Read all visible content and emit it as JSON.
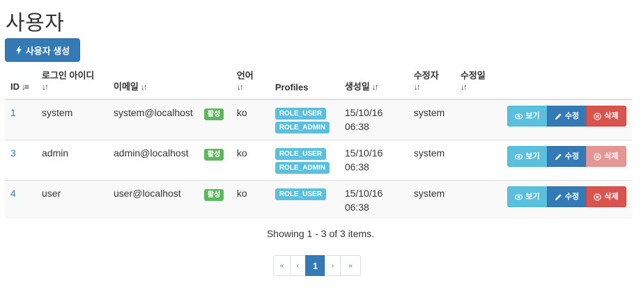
{
  "page": {
    "title": "사용자"
  },
  "toolbar": {
    "create_label": "사용자 생성"
  },
  "table": {
    "headers": {
      "id": "ID",
      "login": "로그인 아이디",
      "email": "이메일",
      "lang": "언어",
      "profiles": "Profiles",
      "created": "생성일",
      "modifier": "수정자",
      "modified": "수정일"
    },
    "rows": [
      {
        "id": "1",
        "login": "system",
        "email": "system@localhost",
        "status": "활성",
        "lang": "ko",
        "roles": [
          "ROLE_USER",
          "ROLE_ADMIN"
        ],
        "created_date": "15/10/16",
        "created_time": "06:38",
        "modifier": "system",
        "modified": "",
        "delete_disabled": false
      },
      {
        "id": "3",
        "login": "admin",
        "email": "admin@localhost",
        "status": "활성",
        "lang": "ko",
        "roles": [
          "ROLE_USER",
          "ROLE_ADMIN"
        ],
        "created_date": "15/10/16",
        "created_time": "06:38",
        "modifier": "system",
        "modified": "",
        "delete_disabled": true
      },
      {
        "id": "4",
        "login": "user",
        "email": "user@localhost",
        "status": "활성",
        "lang": "ko",
        "roles": [
          "ROLE_USER"
        ],
        "created_date": "15/10/16",
        "created_time": "06:38",
        "modifier": "system",
        "modified": "",
        "delete_disabled": false
      }
    ],
    "actions": {
      "view": "보기",
      "edit": "수정",
      "delete": "삭제"
    }
  },
  "summary": "Showing 1 - 3 of 3 items.",
  "pagination": {
    "first": "«",
    "prev": "‹",
    "current": "1",
    "next": "›",
    "last": "»"
  },
  "colors": {
    "primary": "#337ab7",
    "info": "#5bc0de",
    "danger": "#d9534f",
    "success": "#5cb85c"
  }
}
